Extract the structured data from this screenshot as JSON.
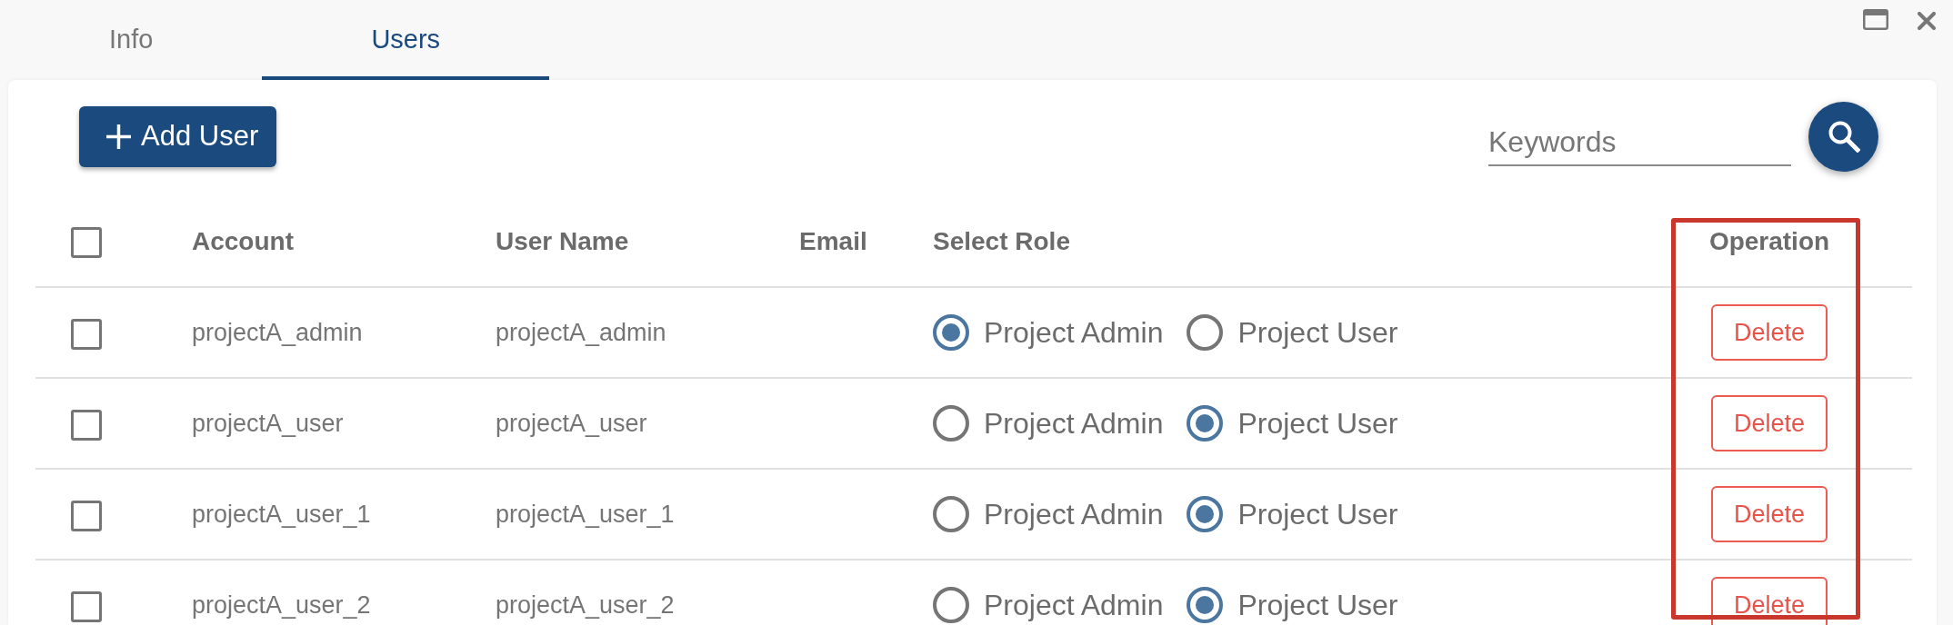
{
  "tabs": [
    {
      "label": "Info",
      "selected": false
    },
    {
      "label": "Users",
      "selected": true
    }
  ],
  "toolbar": {
    "add_button": "Add User",
    "search": {
      "placeholder": "Keywords"
    }
  },
  "table": {
    "select_all": {
      "checked": false
    },
    "columns": [
      {
        "label": "Account",
        "highlighted": false
      },
      {
        "label": "User Name",
        "highlighted": false
      },
      {
        "label": "Email",
        "highlighted": false
      },
      {
        "label": "Select Role",
        "highlighted": false
      },
      {
        "label": "Operation",
        "highlighted": true
      }
    ],
    "rows": [
      {
        "checked": false,
        "account": "projectA_admin",
        "user_name": "projectA_admin",
        "roles": [
          {
            "label": "Project Admin",
            "selected": true
          },
          {
            "label": "Project User",
            "selected": false
          }
        ],
        "action": "Delete"
      },
      {
        "checked": false,
        "account": "projectA_user",
        "user_name": "projectA_user",
        "roles": [
          {
            "label": "Project Admin",
            "selected": false
          },
          {
            "label": "Project User",
            "selected": true
          }
        ],
        "action": "Delete"
      },
      {
        "checked": false,
        "account": "projectA_user_1",
        "user_name": "projectA_user_1",
        "roles": [
          {
            "label": "Project Admin",
            "selected": false
          },
          {
            "label": "Project User",
            "selected": true
          }
        ],
        "action": "Delete"
      },
      {
        "checked": false,
        "account": "projectA_user_2",
        "user_name": "projectA_user_2",
        "roles": [
          {
            "label": "Project Admin",
            "selected": false
          },
          {
            "label": "Project User",
            "selected": true
          }
        ],
        "action": "Delete"
      }
    ]
  }
}
